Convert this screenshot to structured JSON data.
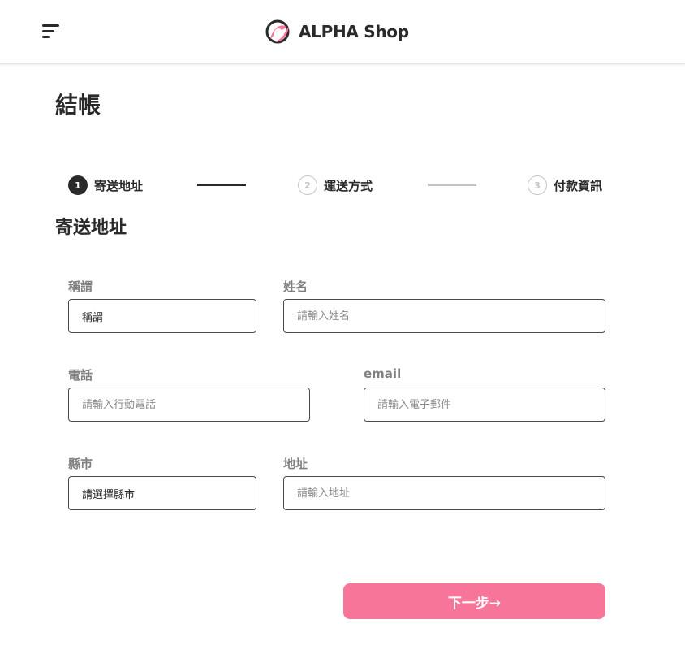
{
  "header": {
    "brand_name": "ALPHA Shop",
    "menu_icon": "hamburger-menu-icon",
    "logo_icon": "alpha-logo-icon",
    "brand_color": "#f67599"
  },
  "page": {
    "title": "結帳"
  },
  "stepper": {
    "steps": [
      {
        "number": "1",
        "label": "寄送地址",
        "state": "active"
      },
      {
        "number": "2",
        "label": "運送方式",
        "state": "inactive"
      },
      {
        "number": "3",
        "label": "付款資訊",
        "state": "inactive"
      }
    ]
  },
  "form": {
    "section_title": "寄送地址",
    "salutation": {
      "label": "稱謂",
      "value": "稱謂"
    },
    "name": {
      "label": "姓名",
      "placeholder": "請輸入姓名"
    },
    "phone": {
      "label": "電話",
      "placeholder": "請輸入行動電話"
    },
    "email": {
      "label": "email",
      "placeholder": "請輸入電子郵件"
    },
    "city": {
      "label": "縣市",
      "value": "請選擇縣市"
    },
    "address": {
      "label": "地址",
      "placeholder": "請輸入地址"
    }
  },
  "actions": {
    "next_label": "下一步→"
  }
}
